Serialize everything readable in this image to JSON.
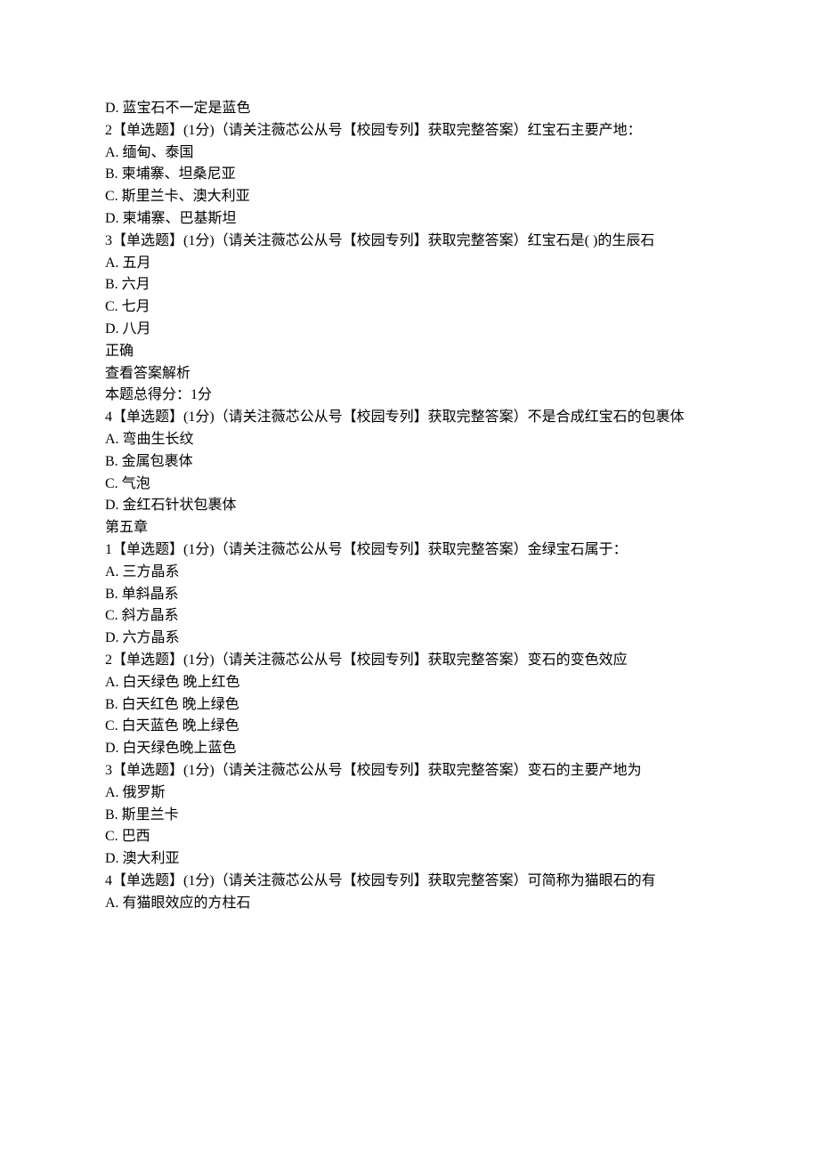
{
  "lines": [
    "D. 蓝宝石不一定是蓝色",
    "2【单选题】(1分)（请关注薇芯公从号【校园专列】获取完整答案）红宝石主要产地：",
    "A. 缅甸、泰国",
    "B. 柬埔寨、坦桑尼亚",
    "C. 斯里兰卡、澳大利亚",
    "D. 柬埔寨、巴基斯坦",
    "3【单选题】(1分)（请关注薇芯公从号【校园专列】获取完整答案）红宝石是( )的生辰石",
    "A. 五月",
    "B. 六月",
    "C. 七月",
    "D. 八月",
    "正确",
    "查看答案解析",
    "本题总得分：1分",
    "4【单选题】(1分)（请关注薇芯公从号【校园专列】获取完整答案）不是合成红宝石的包裹体",
    "A. 弯曲生长纹",
    "B. 金属包裹体",
    "C. 气泡",
    "D. 金红石针状包裹体",
    "第五章",
    "1【单选题】(1分)（请关注薇芯公从号【校园专列】获取完整答案）金绿宝石属于：",
    "A. 三方晶系",
    "B. 单斜晶系",
    "C. 斜方晶系",
    "D. 六方晶系",
    "2【单选题】(1分)（请关注薇芯公从号【校园专列】获取完整答案）变石的变色效应",
    "A. 白天绿色 晚上红色",
    "B. 白天红色 晚上绿色",
    "C. 白天蓝色 晚上绿色",
    "D. 白天绿色晚上蓝色",
    "3【单选题】(1分)（请关注薇芯公从号【校园专列】获取完整答案）变石的主要产地为",
    "A. 俄罗斯",
    "B. 斯里兰卡",
    "C. 巴西",
    "D. 澳大利亚",
    "4【单选题】(1分)（请关注薇芯公从号【校园专列】获取完整答案）可简称为猫眼石的有",
    "A. 有猫眼效应的方柱石"
  ]
}
